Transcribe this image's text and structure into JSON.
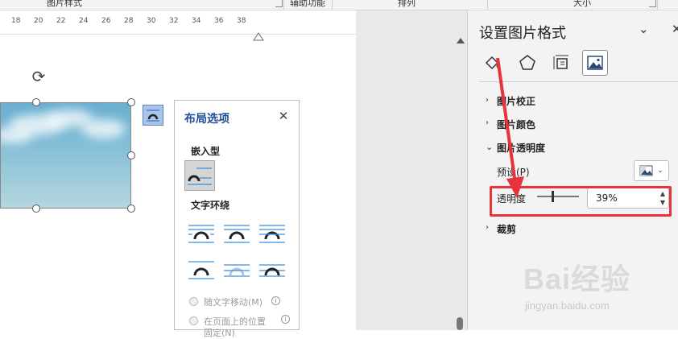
{
  "ribbon": {
    "groups": [
      "图片样式",
      "辅助功能",
      "排列",
      "大小"
    ]
  },
  "ruler": {
    "numbers": [
      "18",
      "20",
      "22",
      "24",
      "26",
      "28",
      "30",
      "32",
      "34",
      "36",
      "38"
    ]
  },
  "layout_options": {
    "title": "布局选项",
    "close_icon": "close-icon",
    "inline_heading": "嵌入型",
    "wrap_heading": "文字环绕",
    "move_with_text": "随文字移动(M)",
    "fix_position": "在页面上的位置",
    "fix_position_cont": "固定(N)"
  },
  "format_pane": {
    "title": "设置图片格式",
    "tabs": [
      "fill-line-icon",
      "effects-icon",
      "size-properties-icon",
      "picture-icon"
    ],
    "sections": {
      "corrections": "图片校正",
      "color": "图片颜色",
      "transparency": "图片透明度",
      "crop": "裁剪"
    },
    "preset_label": "预设(P)",
    "transparency_label": "透明度",
    "transparency_value": "39%"
  },
  "watermark": {
    "brand": "Bai经验",
    "url": "jingyan.baidu.com"
  },
  "colors": {
    "accent": "#1f4e9a",
    "highlight": "#e8323c",
    "layout_icon_blue": "#4a90d9"
  }
}
